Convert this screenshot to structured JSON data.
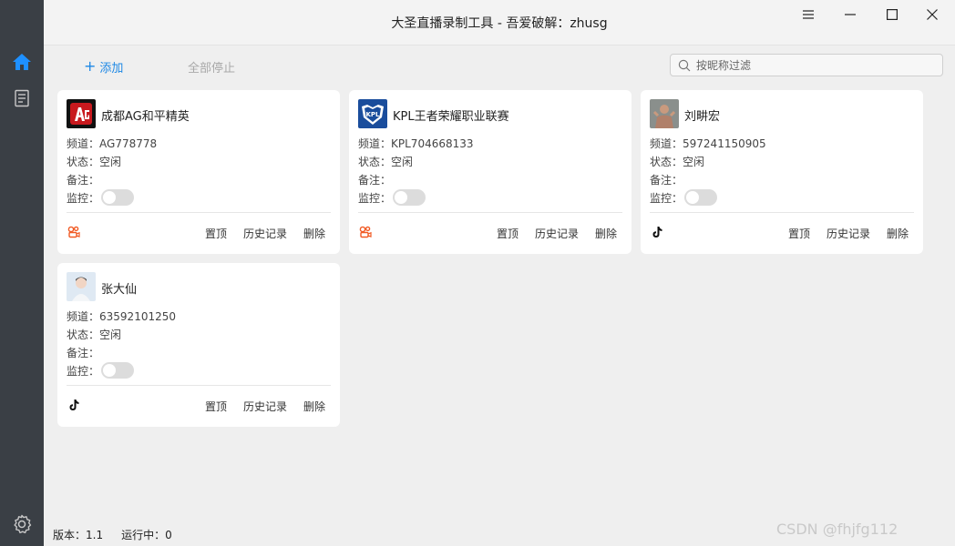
{
  "window": {
    "title": "大圣直播录制工具 - 吾爱破解：zhusg"
  },
  "sidebar": {
    "items": [
      {
        "icon": "home-icon"
      },
      {
        "icon": "list-icon"
      },
      {
        "icon": "gear-icon"
      }
    ]
  },
  "toolbar": {
    "add_label": "添加",
    "stop_all_label": "全部停止",
    "search_placeholder": "按昵称过滤"
  },
  "labels": {
    "channel": "频道：",
    "state": "状态：",
    "note": "备注：",
    "monitor": "监控：",
    "pin": "置顶",
    "history": "历史记录",
    "delete": "删除"
  },
  "cards": [
    {
      "name": "成都AG和平精英",
      "channel": "AG778778",
      "state": "空闲",
      "note": "",
      "monitor": false,
      "platform": "kuaishou-icon"
    },
    {
      "name": "KPL王者荣耀职业联赛",
      "channel": "KPL704668133",
      "state": "空闲",
      "note": "",
      "monitor": false,
      "platform": "kuaishou-icon"
    },
    {
      "name": "刘畊宏",
      "channel": "597241150905",
      "state": "空闲",
      "note": "",
      "monitor": false,
      "platform": "tiktok-icon"
    },
    {
      "name": "张大仙",
      "channel": "63592101250",
      "state": "空闲",
      "note": "",
      "monitor": false,
      "platform": "tiktok-icon"
    }
  ],
  "statusbar": {
    "version": "版本：1.1",
    "running": "运行中：0"
  },
  "watermark": "CSDN @fhjfg112",
  "colors": {
    "sidebar": "#3a3f45",
    "accent": "#1e88e5",
    "kuaishou": "#f15a24"
  }
}
